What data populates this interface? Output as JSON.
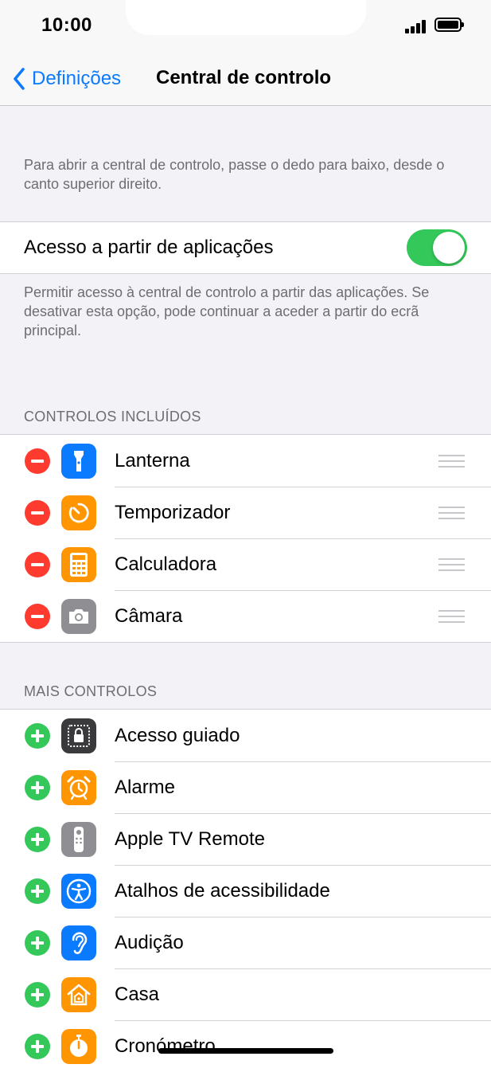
{
  "status_bar": {
    "time": "10:00"
  },
  "nav": {
    "back_label": "Definições",
    "title": "Central de controlo"
  },
  "intro": "Para abrir a central de controlo, passe o dedo para baixo, desde o canto superior direito.",
  "access_toggle": {
    "label": "Acesso a partir de aplicações",
    "on": true
  },
  "access_desc": "Permitir acesso à central de controlo a partir das aplicações. Se desativar esta opção, pode continuar a aceder a partir do ecrã principal.",
  "included": {
    "header": "CONTROLOS INCLUÍDOS",
    "items": [
      {
        "label": "Lanterna",
        "icon": "flashlight-icon",
        "color": "#0a7aff"
      },
      {
        "label": "Temporizador",
        "icon": "timer-icon",
        "color": "#ff9500"
      },
      {
        "label": "Calculadora",
        "icon": "calculator-icon",
        "color": "#ff9500"
      },
      {
        "label": "Câmara",
        "icon": "camera-icon",
        "color": "#8e8e93"
      }
    ]
  },
  "more": {
    "header": "MAIS CONTROLOS",
    "items": [
      {
        "label": "Acesso guiado",
        "icon": "guided-access-icon",
        "color": "#3a3a3c"
      },
      {
        "label": "Alarme",
        "icon": "alarm-icon",
        "color": "#ff9500"
      },
      {
        "label": "Apple TV Remote",
        "icon": "tv-remote-icon",
        "color": "#8e8e93"
      },
      {
        "label": "Atalhos de acessibilidade",
        "icon": "accessibility-icon",
        "color": "#0a7aff"
      },
      {
        "label": "Audição",
        "icon": "hearing-icon",
        "color": "#0a7aff"
      },
      {
        "label": "Casa",
        "icon": "home-icon",
        "color": "#ff9500"
      },
      {
        "label": "Cronómetro",
        "icon": "stopwatch-icon",
        "color": "#ff9500"
      }
    ]
  },
  "colors": {
    "accent": "#0a7aff",
    "toggle_on": "#34c759",
    "remove": "#ff3b30",
    "add": "#34c759"
  }
}
